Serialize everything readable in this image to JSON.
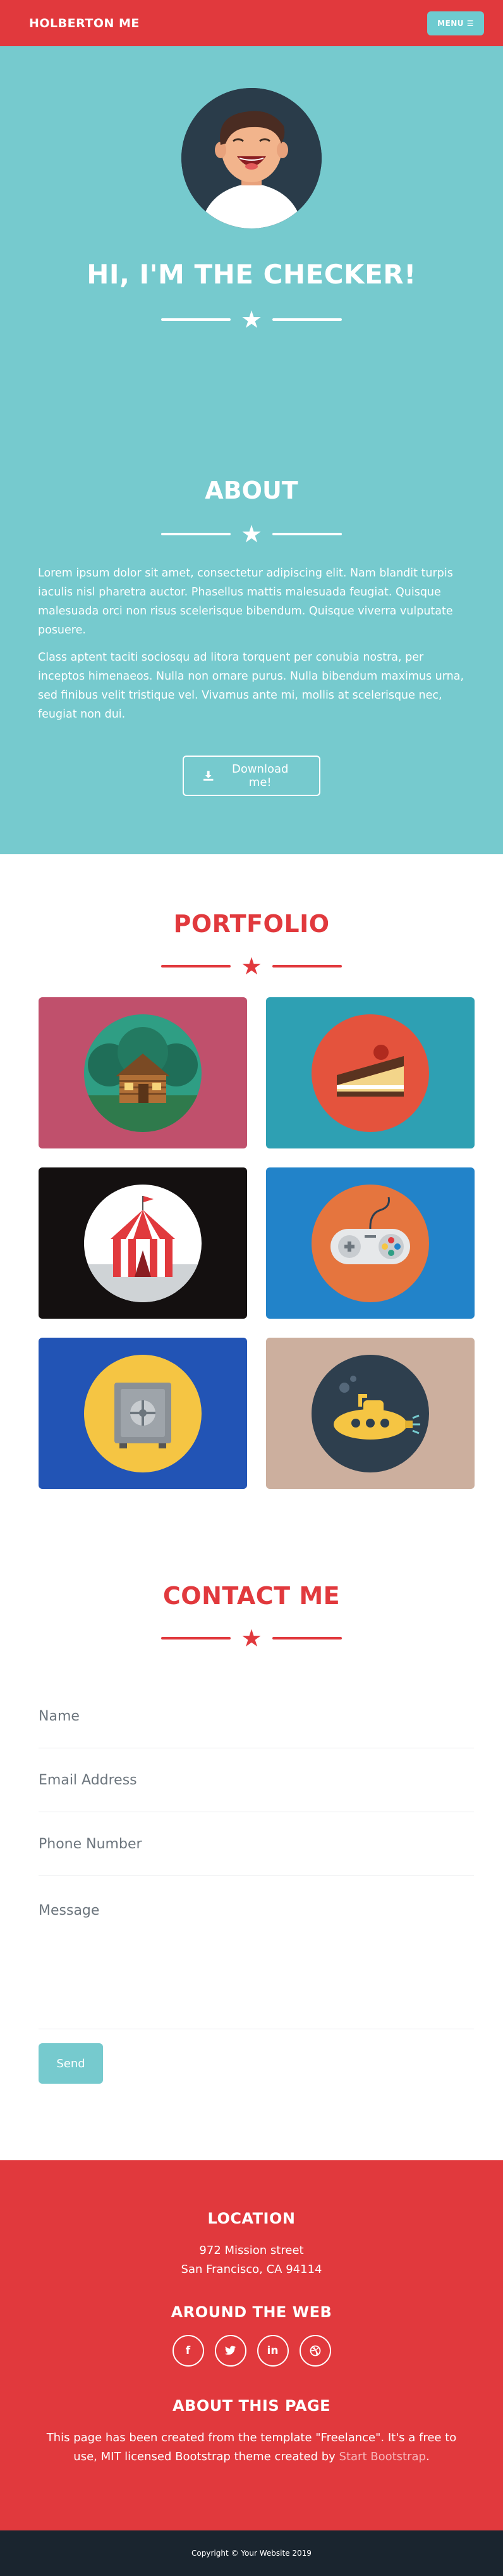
{
  "navbar": {
    "brand": "HOLBERTON ME",
    "menu_label": "MENU ☰"
  },
  "masthead": {
    "title": "HI, I'M THE CHECKER!"
  },
  "about": {
    "title": "ABOUT",
    "paragraph_1": "Lorem ipsum dolor sit amet, consectetur adipiscing elit. Nam blandit turpis iaculis nisl pharetra auctor. Phasellus mattis malesuada feugiat. Quisque malesuada orci non risus scelerisque bibendum. Quisque viverra vulputate posuere.",
    "paragraph_2": "Class aptent taciti sociosqu ad litora torquent per conubia nostra, per inceptos himenaeos. Nulla non ornare purus. Nulla bibendum maximus urna, sed finibus velit tristique vel. Vivamus ante mi, mollis at scelerisque nec, feugiat non dui.",
    "download_label": "Download me!"
  },
  "portfolio": {
    "title": "PORTFOLIO",
    "items": [
      {
        "name": "cabin",
        "bg": "#c0506c",
        "disc": "#2f9e84"
      },
      {
        "name": "cake",
        "bg": "#2ea0b3",
        "disc": "#e4533d"
      },
      {
        "name": "circus",
        "bg": "#141010",
        "disc": "#ffffff"
      },
      {
        "name": "game-controller",
        "bg": "#2283c9",
        "disc": "#e5753e"
      },
      {
        "name": "safe",
        "bg": "#2254b5",
        "disc": "#f5c543"
      },
      {
        "name": "submarine",
        "bg": "#ccaf9e",
        "disc": "#2e3f4e"
      }
    ]
  },
  "contact": {
    "title": "CONTACT ME",
    "name_placeholder": "Name",
    "email_placeholder": "Email Address",
    "phone_placeholder": "Phone Number",
    "message_placeholder": "Message",
    "send_label": "Send"
  },
  "footer": {
    "location_title": "LOCATION",
    "address_line_1": "972 Mission street",
    "address_line_2": "San Francisco, CA 94114",
    "web_title": "AROUND THE WEB",
    "socials": [
      "facebook-icon",
      "twitter-icon",
      "linkedin-icon",
      "dribbble-icon"
    ],
    "about_title": "ABOUT THIS PAGE",
    "about_text_1": "This page has been created from the template \"Freelance\". It's a free to use, MIT licensed Bootstrap theme created by ",
    "about_link": "Start Bootstrap",
    "about_text_2": "."
  },
  "copyright": "Copyright © Your Website 2019",
  "colors": {
    "red": "#e1393d",
    "teal": "#76cace",
    "dark": "#1a252f"
  }
}
